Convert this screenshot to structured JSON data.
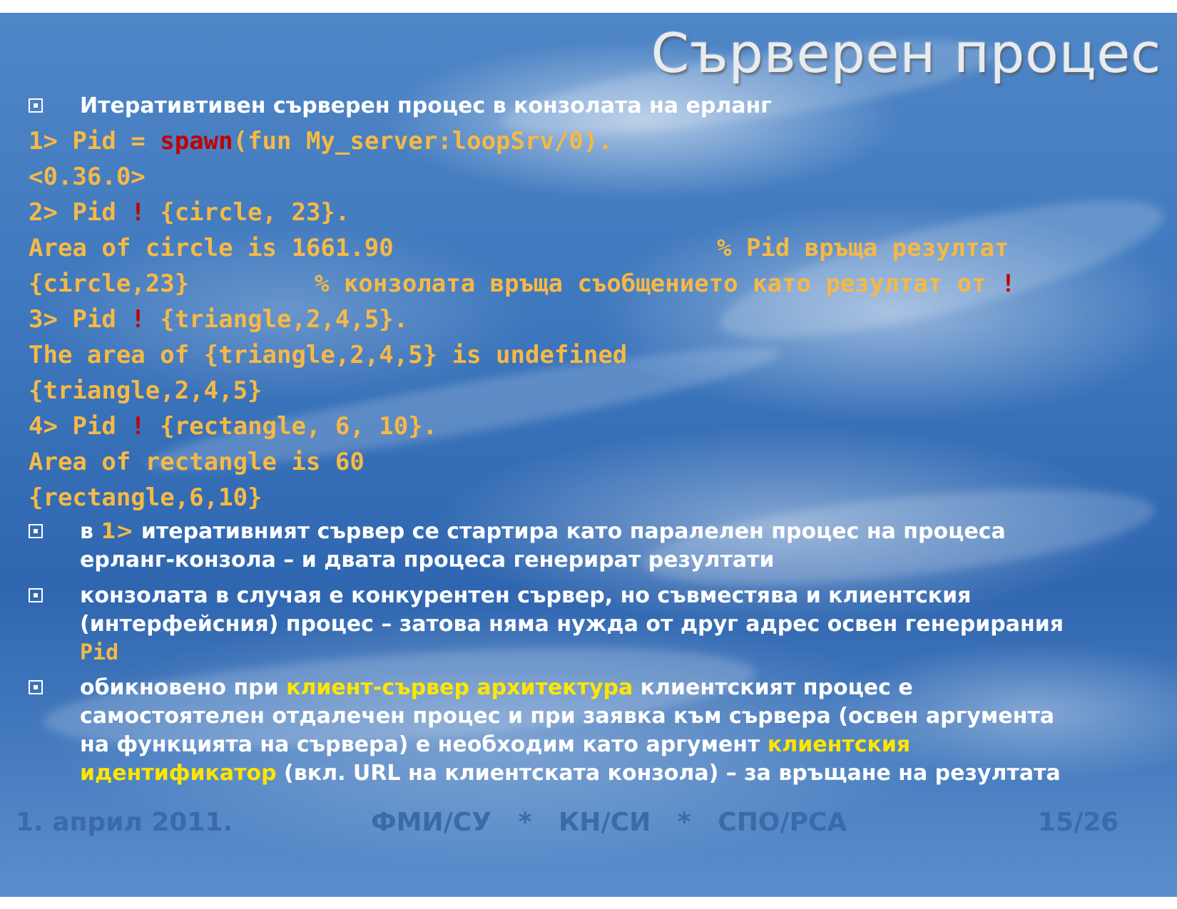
{
  "title": "Сърверен процес",
  "intro": "Итеративтивен сърверен процес в конзолата на ерланг",
  "console": {
    "l1_prompt": "1> Pid = ",
    "l1_spawn": "spawn",
    "l1_rest": "(fun My_server:loopSrv/0).",
    "l2": "<0.36.0>",
    "l3_prompt": "2> Pid ",
    "bang": "!",
    "l3_rest": " {circle, 23}.",
    "l4_text": "Area of circle is 1661.90",
    "l4_comment": "% Pid връща резултат",
    "l5_text": "{circle,23}",
    "l5_comment": "% конзолата връща съобщението като резултат от ",
    "l6_prompt": "3> Pid ",
    "l6_rest": " {triangle,2,4,5}.",
    "l7": "The area of {triangle,2,4,5} is undefined",
    "l8": "{triangle,2,4,5}",
    "l9_prompt": "4> Pid ",
    "l9_rest": " {rectangle, 6, 10}.",
    "l10": "Area of rectangle is 60",
    "l11": "{rectangle,6,10}"
  },
  "bullets": {
    "b2_pre": "в ",
    "b2_code": "1>",
    "b2_line1": " итеративният сървер се стартира като паралелен процес на процеса",
    "b2_line2": "ерланг-конзола – и двата процеса генерират резултати",
    "b3_line1": "конзолата в случая е конкурентен сървер, но съвместява и клиентския",
    "b3_line2": "(интерфейсния) процес – затова няма нужда от друг адрес освен генерирания",
    "b3_code": "Pid",
    "b4_pre": "обикновено при ",
    "b4_hl1": "клиент-сървер архитектура",
    "b4_line1_rest": " клиентският процес е",
    "b4_line2": "самостоятелен отдалечен процес и при заявка към сървера (освен аргумента",
    "b4_line3_pre": "на функцията на сървера) е необходим като аргумент ",
    "b4_hl2": "клиентския",
    "b4_hl3": "идентификатор",
    "b4_line4_rest": " (вкл. URL на клиентската конзола) – за връщане на резултата"
  },
  "footer": {
    "date": "1. април 2011.",
    "center": "ФМИ/СУ   *   КН/СИ   *   СПО/РСА",
    "page": "15/26"
  },
  "colors": {
    "code": "#f6b945",
    "keyword_red": "#c00000",
    "highlight_yellow": "#ffe600",
    "text_white": "#ffffff",
    "footer": "#3b6aa8"
  }
}
